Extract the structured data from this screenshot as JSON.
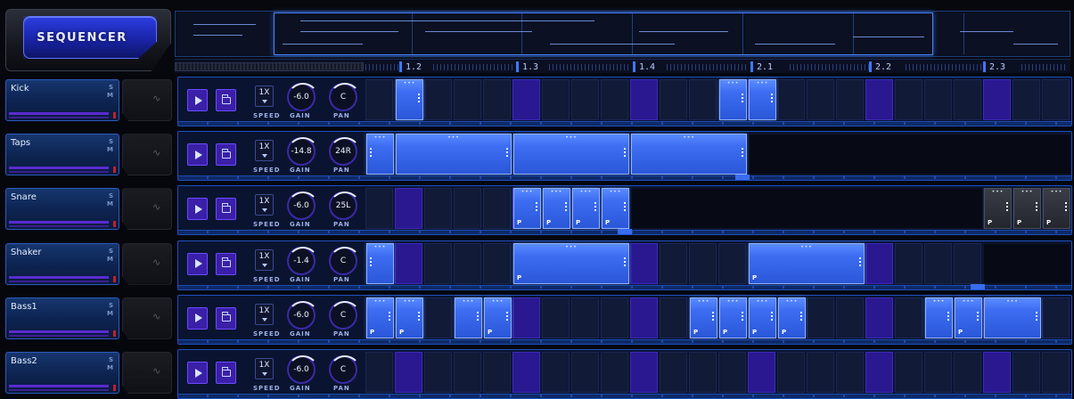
{
  "app": {
    "title": "SEQUENCER"
  },
  "ruler": {
    "labels": [
      "1.2",
      "1.3",
      "1.4",
      "2.1",
      "2.2",
      "2.3"
    ]
  },
  "controls": {
    "speed_label": "SPEED",
    "gain_label": "GAIN",
    "pan_label": "PAN",
    "solo": "S",
    "mute": "M"
  },
  "colors": {
    "accent": "#3d6df2",
    "highlight_cell": "#2a1890",
    "lane_border": "#1f4fbf"
  },
  "tracks": [
    {
      "name": "Kick",
      "speed": "1X",
      "gain": "-6.0",
      "pan": "C",
      "highlight_cells": [
        5,
        9,
        13,
        17,
        21,
        25
      ],
      "empty_from": null,
      "clips": [
        {
          "start": 1,
          "len": 1,
          "p": false
        },
        {
          "start": 12,
          "len": 1,
          "p": false
        },
        {
          "start": 13,
          "len": 1,
          "p": false
        }
      ]
    },
    {
      "name": "Taps",
      "speed": "1X",
      "gain": "-14.8",
      "pan": "24R",
      "highlight_cells": [],
      "empty_from": 13,
      "clips": [
        {
          "start": 0,
          "len": 1,
          "p": false,
          "left": true
        },
        {
          "start": 1,
          "len": 4,
          "p": false
        },
        {
          "start": 5,
          "len": 4,
          "p": false
        },
        {
          "start": 9,
          "len": 4,
          "p": false
        }
      ]
    },
    {
      "name": "Snare",
      "speed": "1X",
      "gain": "-6.0",
      "pan": "25L",
      "highlight_cells": [
        1,
        5,
        9
      ],
      "empty_from": 9,
      "clips": [
        {
          "start": 5,
          "len": 1,
          "p": true
        },
        {
          "start": 6,
          "len": 1,
          "p": true
        },
        {
          "start": 7,
          "len": 1,
          "p": true
        },
        {
          "start": 8,
          "len": 1,
          "p": true
        },
        {
          "start": 21,
          "len": 1,
          "p": true,
          "grey": true
        },
        {
          "start": 22,
          "len": 1,
          "p": true,
          "grey": true
        },
        {
          "start": 23,
          "len": 1,
          "p": true,
          "grey": true
        }
      ]
    },
    {
      "name": "Shaker",
      "speed": "1X",
      "gain": "-1.4",
      "pan": "C",
      "highlight_cells": [
        1,
        9,
        17
      ],
      "empty_from": 21,
      "clips": [
        {
          "start": 0,
          "len": 1,
          "p": false,
          "left": true
        },
        {
          "start": 5,
          "len": 4,
          "p": true
        },
        {
          "start": 13,
          "len": 4,
          "p": true
        }
      ]
    },
    {
      "name": "Bass1",
      "speed": "1X",
      "gain": "-6.0",
      "pan": "C",
      "highlight_cells": [
        5,
        9,
        17,
        21
      ],
      "empty_from": null,
      "clips": [
        {
          "start": 0,
          "len": 1,
          "p": true
        },
        {
          "start": 1,
          "len": 1,
          "p": true
        },
        {
          "start": 3,
          "len": 1,
          "p": false
        },
        {
          "start": 4,
          "len": 1,
          "p": true
        },
        {
          "start": 11,
          "len": 1,
          "p": true
        },
        {
          "start": 12,
          "len": 1,
          "p": true
        },
        {
          "start": 13,
          "len": 1,
          "p": true
        },
        {
          "start": 14,
          "len": 1,
          "p": true
        },
        {
          "start": 19,
          "len": 1,
          "p": false
        },
        {
          "start": 20,
          "len": 1,
          "p": true
        },
        {
          "start": 21,
          "len": 2,
          "p": false
        }
      ]
    },
    {
      "name": "Bass2",
      "speed": "1X",
      "gain": "-6.0",
      "pan": "C",
      "highlight_cells": [
        1,
        5,
        9,
        13,
        17,
        21
      ],
      "empty_from": null,
      "clips": []
    }
  ]
}
